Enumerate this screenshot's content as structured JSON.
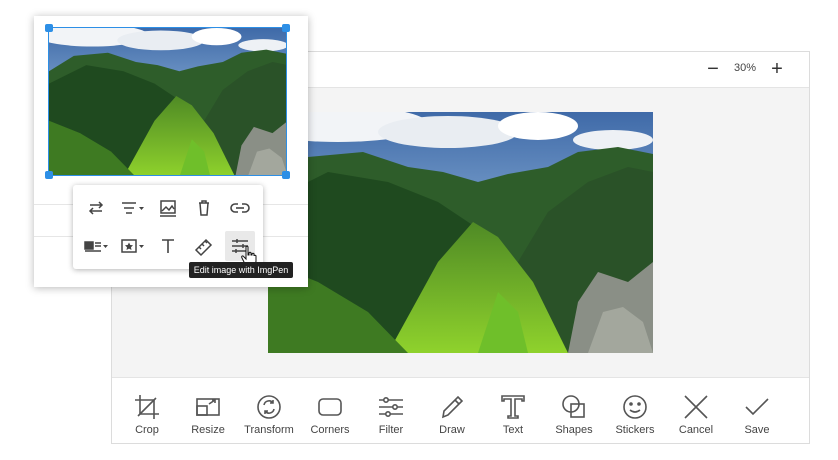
{
  "zoom": {
    "minus_label": "−",
    "value": "30%",
    "plus_label": "+"
  },
  "tools": [
    {
      "label": "Crop",
      "icon": "crop-icon"
    },
    {
      "label": "Resize",
      "icon": "resize-icon"
    },
    {
      "label": "Transform",
      "icon": "transform-icon"
    },
    {
      "label": "Corners",
      "icon": "corners-icon"
    },
    {
      "label": "Filter",
      "icon": "filter-icon"
    },
    {
      "label": "Draw",
      "icon": "draw-icon"
    },
    {
      "label": "Text",
      "icon": "text-icon"
    },
    {
      "label": "Shapes",
      "icon": "shapes-icon"
    },
    {
      "label": "Stickers",
      "icon": "stickers-icon"
    },
    {
      "label": "Cancel",
      "icon": "cancel-icon"
    },
    {
      "label": "Save",
      "icon": "save-icon"
    }
  ],
  "popup_toolbar": {
    "row1": [
      "replace-icon",
      "align-icon",
      "image-alt-icon",
      "delete-icon",
      "link-icon"
    ],
    "row2": [
      "display-icon",
      "style-icon",
      "alt-text-icon",
      "size-icon",
      "edit-image-icon"
    ]
  },
  "tooltip": {
    "text": "Edit image with ImgPen"
  },
  "colors": {
    "accent": "#2d8fe6",
    "icon": "#555555",
    "tooltip_bg": "#222222"
  }
}
